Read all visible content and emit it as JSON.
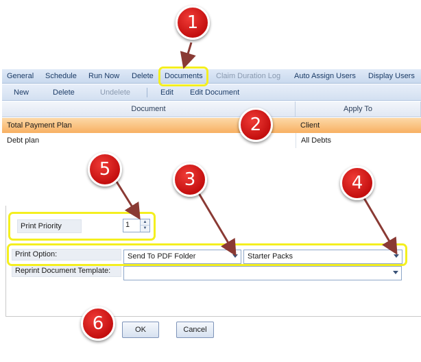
{
  "tabs": [
    {
      "label": "General",
      "state": "normal"
    },
    {
      "label": "Schedule",
      "state": "normal"
    },
    {
      "label": "Run Now",
      "state": "normal"
    },
    {
      "label": "Delete",
      "state": "normal"
    },
    {
      "label": "Documents",
      "state": "active"
    },
    {
      "label": "Claim Duration Log",
      "state": "disabled"
    },
    {
      "label": "Auto Assign Users",
      "state": "normal"
    },
    {
      "label": "Display Users",
      "state": "normal"
    }
  ],
  "toolbar": {
    "new_label": "New",
    "delete_label": "Delete",
    "undelete_label": "Undelete",
    "edit_label": "Edit",
    "edit_document_label": "Edit Document"
  },
  "grid": {
    "columns": [
      "Document",
      "Apply To"
    ],
    "rows": [
      {
        "document": "Total Payment Plan",
        "apply_to": "Client",
        "selected": true
      },
      {
        "document": "Debt plan",
        "apply_to": "All Debts",
        "selected": false
      }
    ]
  },
  "form": {
    "print_priority_label": "Print Priority",
    "print_priority_value": "1",
    "print_option_label": "Print Option:",
    "print_option_value": "Send To PDF Folder",
    "print_option_pack_value": "Starter Packs",
    "reprint_template_label": "Reprint Document Template:",
    "reprint_template_value": ""
  },
  "buttons": {
    "ok_label": "OK",
    "cancel_label": "Cancel"
  },
  "annotations": {
    "badge_1": "1",
    "badge_2": "2",
    "badge_3": "3",
    "badge_4": "4",
    "badge_5": "5",
    "badge_6": "6",
    "highlight_color": "#f4ef1f",
    "badge_color": "#d71a1a",
    "arrow_color": "#8a3a34"
  }
}
